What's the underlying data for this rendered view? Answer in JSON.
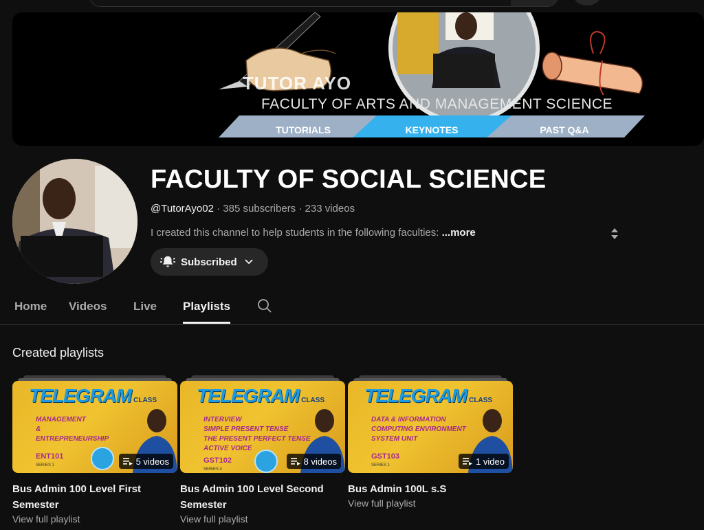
{
  "banner": {
    "name": "TUTOR AYO",
    "faculty": "FACULTY  OF ARTS AND MANAGEMENT SCIENCE",
    "tabs": [
      "TUTORIALS",
      "KEYNOTES",
      "PAST Q&A"
    ]
  },
  "channel": {
    "title": "FACULTY OF SOCIAL SCIENCE",
    "handle": "@TutorAyo02",
    "subscribers": "385 subscribers",
    "videos": "233 videos",
    "description": "I created this channel to help students in the following faculties:",
    "more_label": "...more",
    "subscribe_label": "Subscribed"
  },
  "tabs": {
    "home": "Home",
    "videos": "Videos",
    "live": "Live",
    "playlists": "Playlists"
  },
  "section_title": "Created playlists",
  "playlists": [
    {
      "title": "Bus Admin 100 Level First Semester",
      "count": "5 videos",
      "link": "View full playlist",
      "thumb_brand": "TELEGRAM",
      "thumb_brand_small": "CLASS",
      "thumb_lines": [
        "MANAGEMENT",
        "&",
        "ENTREPRENEURSHIP"
      ],
      "thumb_course": "ENT101",
      "thumb_series": "SERIES 1"
    },
    {
      "title": "Bus Admin 100 Level Second Semester",
      "count": "8 videos",
      "link": "View full playlist",
      "thumb_brand": "TELEGRAM",
      "thumb_brand_small": "CLASS",
      "thumb_lines": [
        "INTERVIEW",
        "SIMPLE PRESENT TENSE",
        "THE PRESENT PERFECT TENSE",
        "ACTIVE VOICE"
      ],
      "thumb_course": "GST102",
      "thumb_series": "SERIES 4"
    },
    {
      "title": "Bus Admin 100L s.S",
      "count": "1 video",
      "link": "View full playlist",
      "thumb_brand": "TELEGRAM",
      "thumb_brand_small": "CLASS",
      "thumb_lines": [
        "DATA & INFORMATION",
        "COMPUTING ENVIRONMENT",
        "SYSTEM UNIT"
      ],
      "thumb_course": "GST103",
      "thumb_series": "SERIES 1"
    }
  ],
  "icons": {
    "bell": "bell-icon",
    "chevron": "chevron-down-icon",
    "search": "search-icon",
    "playlist": "playlist-icon",
    "telegram": "telegram-icon"
  },
  "colors": {
    "background": "#0f0f0f",
    "accent_blue": "#3ab4f2",
    "banner_tab": "#8fa2b8",
    "thumb_yellow": "#f0c330"
  }
}
